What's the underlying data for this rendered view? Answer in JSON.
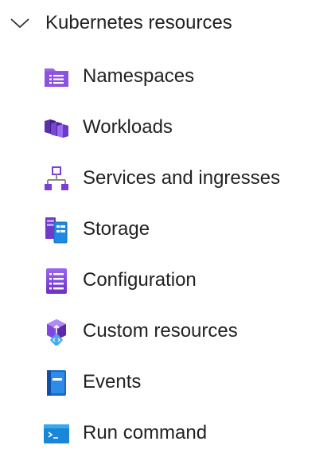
{
  "section": {
    "title": "Kubernetes resources",
    "expanded_icon": "chevron-down-icon"
  },
  "items": [
    {
      "label": "Namespaces",
      "icon": "namespaces-icon"
    },
    {
      "label": "Workloads",
      "icon": "workloads-icon"
    },
    {
      "label": "Services and ingresses",
      "icon": "services-icon"
    },
    {
      "label": "Storage",
      "icon": "storage-icon"
    },
    {
      "label": "Configuration",
      "icon": "configuration-icon"
    },
    {
      "label": "Custom resources",
      "icon": "custom-resources-icon"
    },
    {
      "label": "Events",
      "icon": "events-icon"
    },
    {
      "label": "Run command",
      "icon": "run-command-icon"
    }
  ]
}
